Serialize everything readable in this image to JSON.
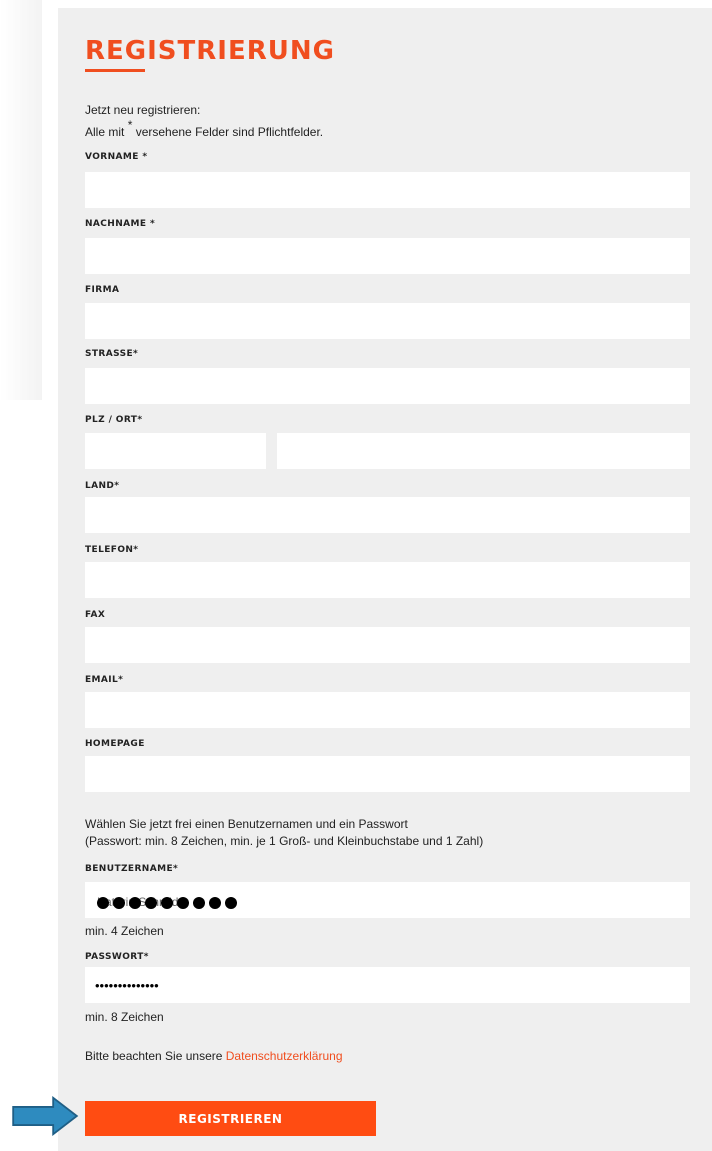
{
  "form": {
    "title": "REGISTRIERUNG",
    "intro_line1": "Jetzt neu registrieren:",
    "intro_line2_pre": "Alle mit ",
    "intro_line2_star": "*",
    "intro_line2_post": " versehene Felder sind Pflichtfelder.",
    "fields": {
      "vorname": "VORNAME *",
      "nachname": "NACHNAME *",
      "firma": "FIRMA",
      "strasse": "STRASSE*",
      "plz_ort": "PLZ / ORT*",
      "land": "LAND*",
      "telefon": "TELEFON*",
      "fax": "FAX",
      "email": "EMAIL*",
      "homepage": "HOMEPAGE"
    },
    "credentials_line1": "Wählen Sie jetzt frei einen Benutzernamen und ein Passwort",
    "credentials_line2": "(Passwort: min. 8 Zeichen, min. je 1 Groß- und Kleinbuchstabe und 1 Zahl)",
    "benutzername_label": "BENUTZERNAME*",
    "benutzername_value_faint": "Kathrin Schmid",
    "benutzername_hint": "min. 4 Zeichen",
    "passwort_label": "PASSWORT*",
    "passwort_value": "••••••••••••••",
    "passwort_hint": "min. 8 Zeichen",
    "privacy_text": "Bitte beachten Sie unsere ",
    "privacy_link": "Datenschutzerklärung",
    "submit_label": "REGISTRIEREN"
  },
  "colors": {
    "accent": "#f04e1f",
    "button": "#ff4c12",
    "panel": "#efefef",
    "arrow": "#2e8bbf"
  }
}
